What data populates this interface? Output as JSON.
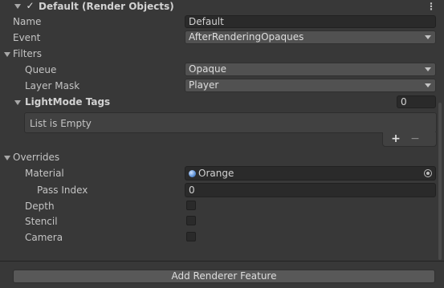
{
  "header": {
    "title": "Default (Render Objects)",
    "enabled_check": "✓",
    "menu_glyph": "⋮"
  },
  "fields": {
    "name_label": "Name",
    "name_value": "Default",
    "event_label": "Event",
    "event_value": "AfterRenderingOpaques"
  },
  "filters": {
    "label": "Filters",
    "queue_label": "Queue",
    "queue_value": "Opaque",
    "layer_mask_label": "Layer Mask",
    "layer_mask_value": "Player",
    "lightmode": {
      "label": "LightMode Tags",
      "count": "0",
      "empty_text": "List is Empty",
      "add_glyph": "+",
      "remove_glyph": "−"
    }
  },
  "overrides": {
    "label": "Overrides",
    "material_label": "Material",
    "material_value": "Orange",
    "pass_index_label": "Pass Index",
    "pass_index_value": "0",
    "depth_label": "Depth",
    "stencil_label": "Stencil",
    "camera_label": "Camera"
  },
  "footer": {
    "add_feature_label": "Add Renderer Feature"
  },
  "colors": {
    "background": "#383838",
    "field": "#2a2a2a",
    "dropdown": "#515151",
    "material_dot": "#5b8fd4"
  }
}
